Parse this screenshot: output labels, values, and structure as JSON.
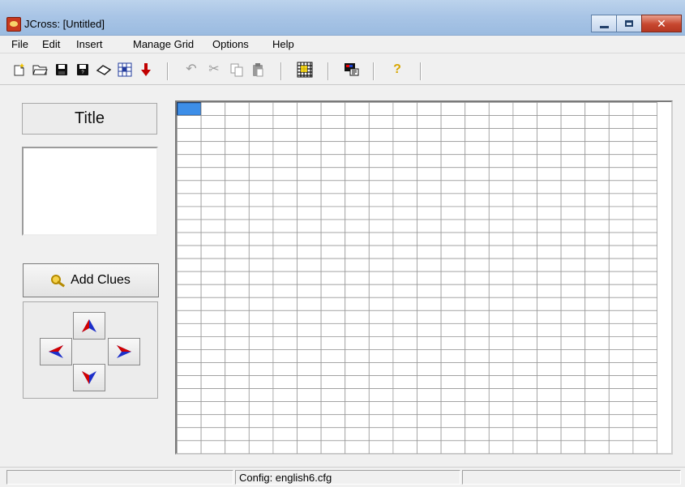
{
  "window": {
    "title": "JCross: [Untitled]",
    "buttons": [
      "minimize",
      "maximize",
      "close"
    ]
  },
  "menubar": {
    "items": [
      "File",
      "Edit",
      "Insert",
      "Manage Grid",
      "Options",
      "Help"
    ]
  },
  "toolbar": {
    "icons": [
      "new-icon",
      "open-icon",
      "save-icon",
      "save-as-icon",
      "eraser-icon",
      "grid-fill-icon",
      "export-icon",
      "undo-icon",
      "cut-icon",
      "copy-icon",
      "paste-icon",
      "grid-resize-icon",
      "screen-icon",
      "help-icon"
    ]
  },
  "left_panel": {
    "title_label": "Title",
    "add_clues_label": "Add Clues"
  },
  "grid": {
    "columns": 20,
    "rows": 27,
    "selected_cell": {
      "row": 1,
      "col": 1
    }
  },
  "status": {
    "config": "Config: english6.cfg"
  },
  "colors": {
    "arrow_red": "#d20000",
    "arrow_blue": "#1d2fc9",
    "selected_cell": "#3d8ee8"
  }
}
